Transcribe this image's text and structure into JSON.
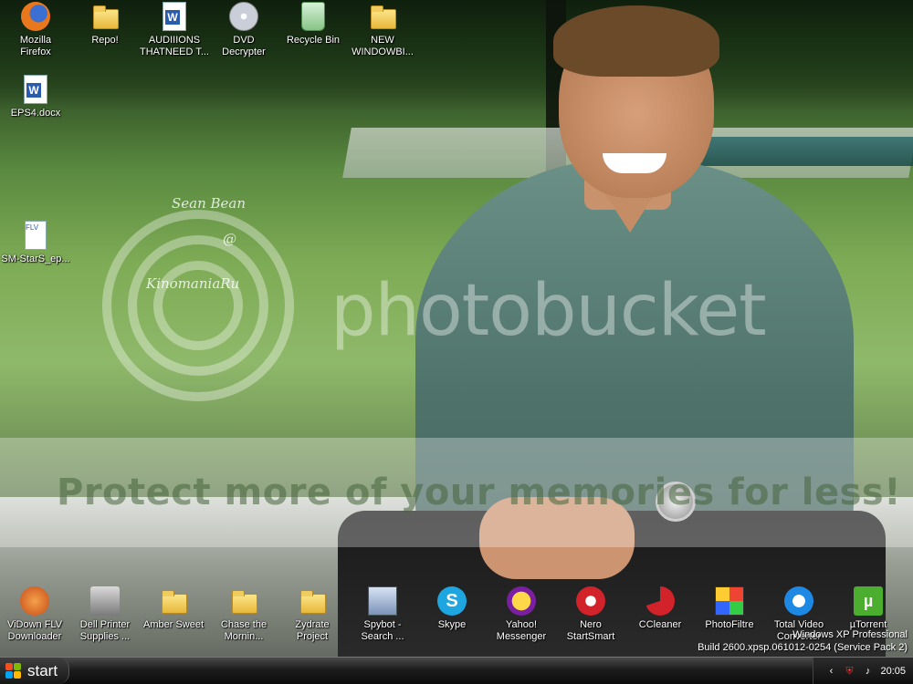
{
  "wallpaper": {
    "signature_lines": [
      "Sean Bean",
      "@",
      "KinomaniaRu"
    ],
    "brand": "photobucket",
    "promo": "Protect more of your memories for less!"
  },
  "desktop_top": [
    {
      "label": "Mozilla\nFirefox",
      "icon": "firefox-icon"
    },
    {
      "label": "Repo!",
      "icon": "folder-icon"
    },
    {
      "label": "AUDIIIONS\nTHATNEED T...",
      "icon": "word-document-icon"
    },
    {
      "label": "DVD\nDecrypter",
      "icon": "dvd-icon"
    },
    {
      "label": "Recycle Bin",
      "icon": "recycle-bin-icon"
    },
    {
      "label": "NEW\nWINDOWBI...",
      "icon": "folder-icon"
    }
  ],
  "desktop_left": [
    {
      "label": "EPS4.docx",
      "icon": "word-document-icon"
    },
    {
      "label": "SM-StarS_ep...",
      "icon": "flv-file-icon"
    }
  ],
  "desktop_bottom": [
    {
      "label": "ViDown FLV\nDownloader",
      "icon": "vidown-icon"
    },
    {
      "label": "Dell Printer\nSupplies ...",
      "icon": "printer-icon"
    },
    {
      "label": "Amber Sweet",
      "icon": "folder-icon"
    },
    {
      "label": "Chase the\nMornin...",
      "icon": "folder-icon"
    },
    {
      "label": "Zydrate\nProject",
      "icon": "folder-icon"
    },
    {
      "label": "Spybot -\nSearch ...",
      "icon": "spybot-icon"
    },
    {
      "label": "Skype",
      "icon": "skype-icon"
    },
    {
      "label": "Yahoo!\nMessenger",
      "icon": "yahoo-messenger-icon"
    },
    {
      "label": "Nero\nStartSmart",
      "icon": "nero-icon"
    },
    {
      "label": "CCleaner",
      "icon": "ccleaner-icon"
    },
    {
      "label": "PhotoFiltre",
      "icon": "photofiltre-icon"
    },
    {
      "label": "Total Video\nConverter",
      "icon": "total-video-converter-icon"
    },
    {
      "label": "µTorrent",
      "icon": "utorrent-icon"
    }
  ],
  "os_watermark": {
    "line1": "Windows XP Professional",
    "line2": "Build 2600.xpsp.061012-0254 (Service Pack 2)"
  },
  "taskbar": {
    "start_label": "start",
    "tray_chevron": "‹",
    "clock": "20:05"
  },
  "colors": {
    "logo_red": "#f25022",
    "logo_green": "#7fba00",
    "logo_blue": "#00a4ef",
    "logo_yellow": "#ffb900"
  }
}
